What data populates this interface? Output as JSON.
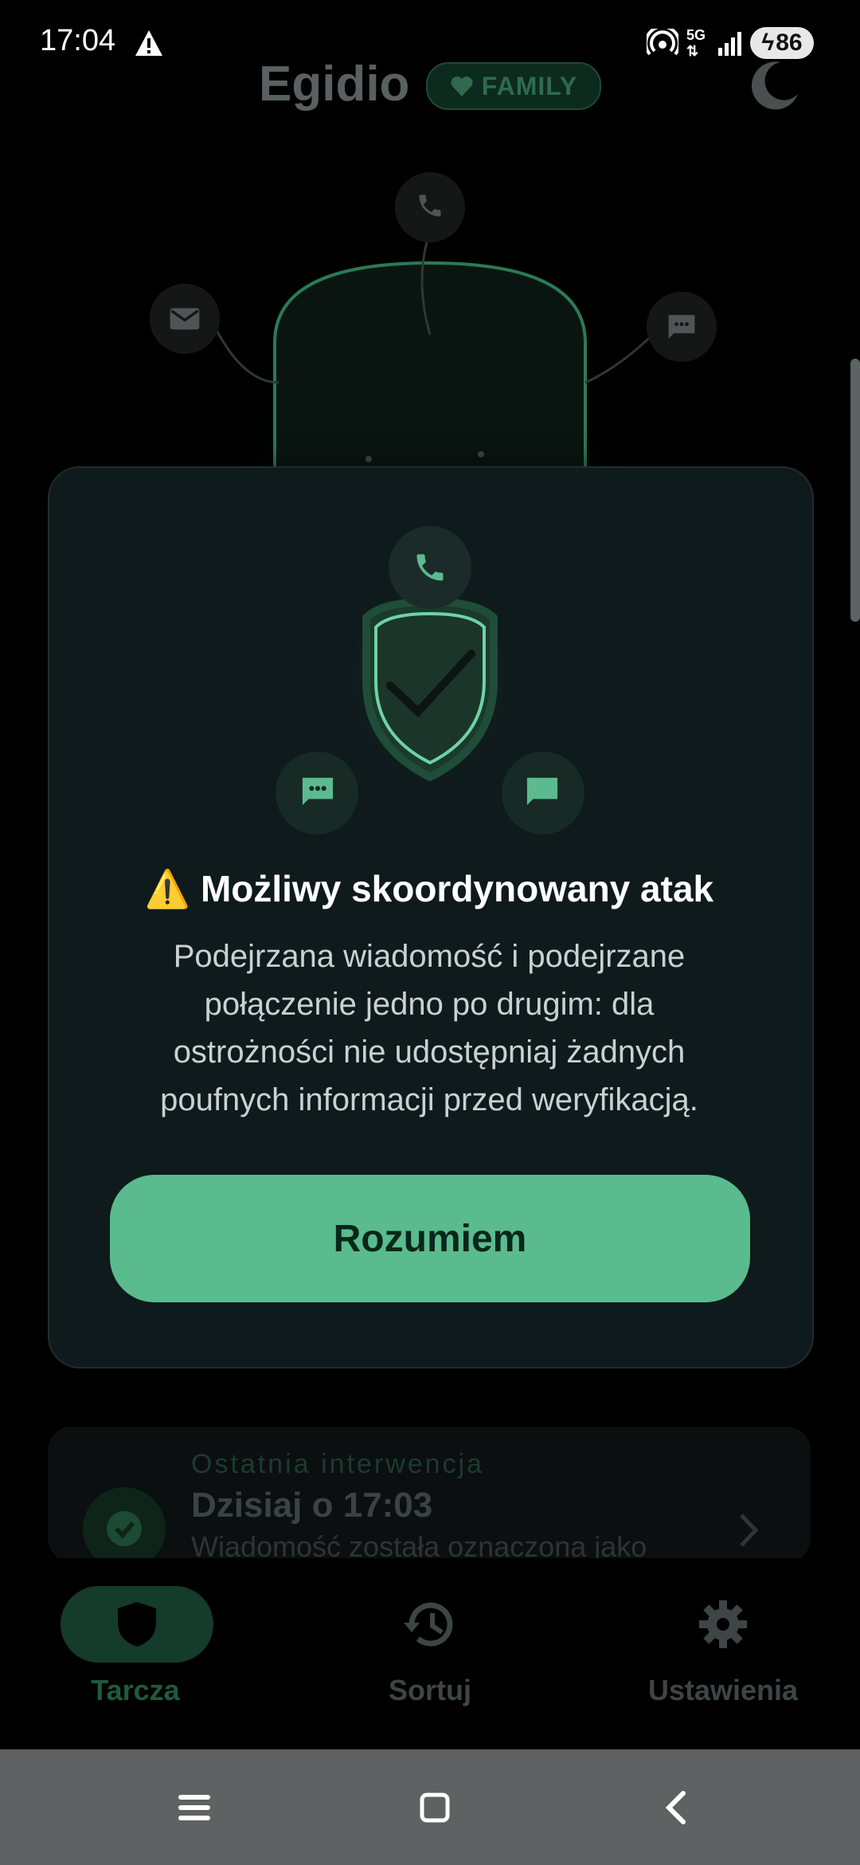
{
  "status_bar": {
    "time": "17:04",
    "battery": "86",
    "network": "5G"
  },
  "header": {
    "title": "Egidio",
    "badge": "FAMILY"
  },
  "modal": {
    "title": "⚠️ Możliwy skoordynowany atak",
    "body_lines": [
      "Podejrzana wiadomość i podejrzane",
      "połączenie jedno po drugim: dla",
      "ostrożności nie udostępniaj żadnych",
      "poufnych informacji przed weryfikacją."
    ],
    "button": "Rozumiem"
  },
  "last_intervention": {
    "label": "Ostatnia interwencja",
    "time": "Dzisiaj o 17:03",
    "desc": "Wiadomość została oznaczona jako"
  },
  "nav": {
    "tab1": "Tarcza",
    "tab2": "Sortuj",
    "tab3": "Ustawienia",
    "active": "Tarcza"
  },
  "colors": {
    "accent": "#5abb8f",
    "modal_bg": "#0f1a1c",
    "background": "#000000"
  },
  "icons": [
    "phone-icon",
    "mail-icon",
    "chat-icon",
    "shield-check-icon",
    "moon-icon",
    "heart-icon",
    "shield-icon",
    "history-icon",
    "gear-icon",
    "chevron-right-icon",
    "menu-icon",
    "home-icon",
    "back-icon"
  ]
}
